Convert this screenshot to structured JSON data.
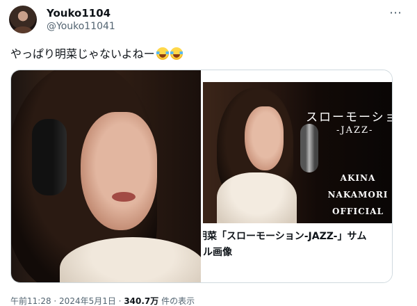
{
  "user": {
    "display_name": "Youko1104",
    "handle": "@Youko11041"
  },
  "menu": {
    "more_icon": "⋯"
  },
  "tweet": {
    "text": "やっぱり明菜じゃないよねー",
    "emojis": [
      "face-with-tears-of-joy",
      "face-with-tears-of-joy"
    ]
  },
  "card": {
    "thumbnail_text": {
      "title": "スローモーショ",
      "subtitle": "-JAZZ-",
      "brand_lines": [
        "AKINA",
        "NAKAMORI",
        "OFFICIAL"
      ]
    },
    "caption_line1": "明菜「スローモーション-JAZZ-」サム",
    "caption_line2": "ル画像"
  },
  "meta": {
    "time": "午前11:28",
    "sep1": " · ",
    "date": "2024年5月1日",
    "sep2": " · ",
    "views_count": "340.7万",
    "views_label": " 件の表示"
  },
  "colors": {
    "text_primary": "#0f1419",
    "text_secondary": "#536471",
    "border": "#cfd9de"
  }
}
